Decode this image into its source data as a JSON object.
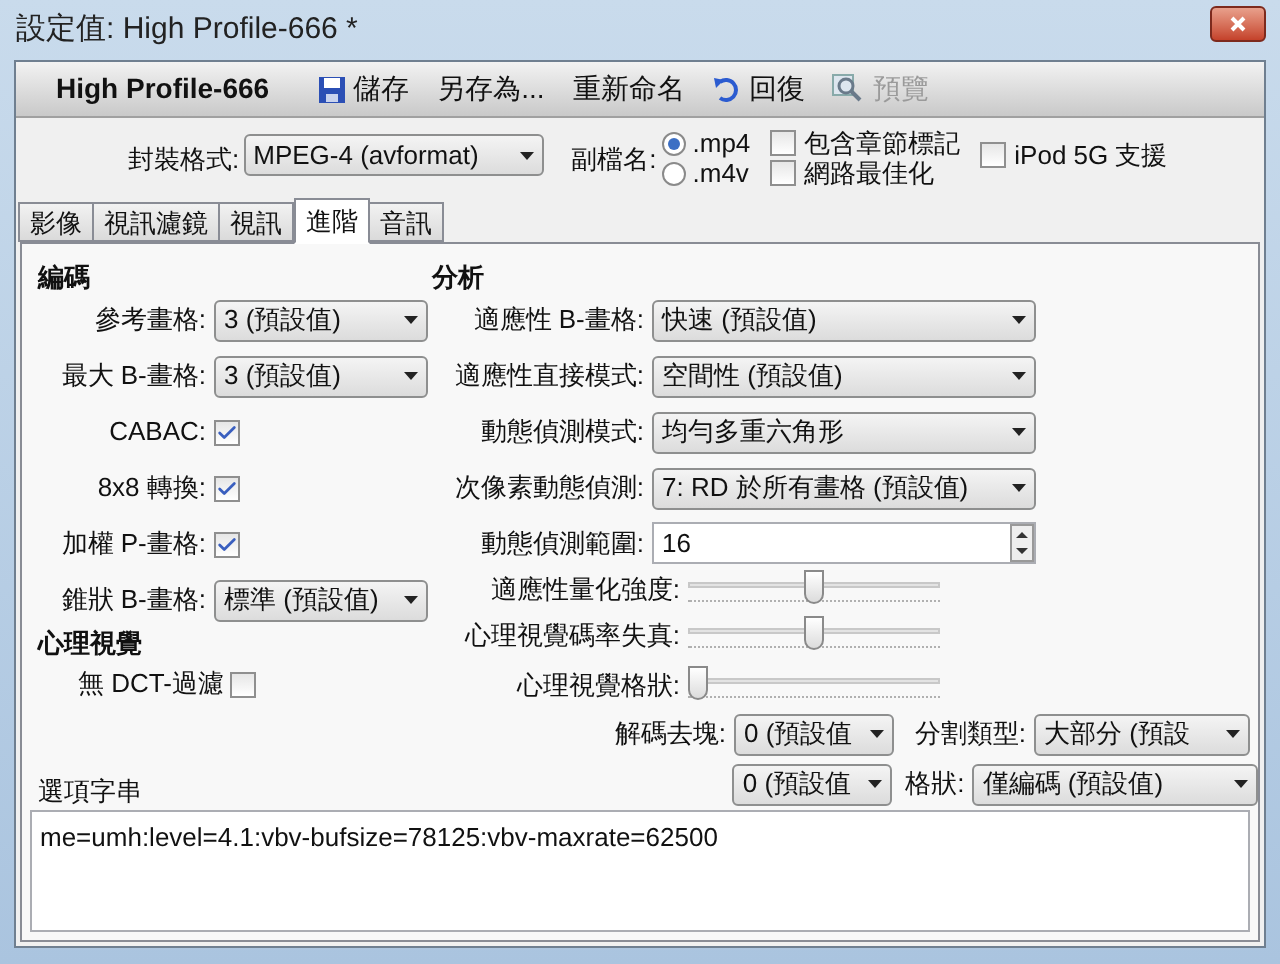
{
  "window": {
    "title": "設定值: High Profile-666 *"
  },
  "toolbar": {
    "preset_name": "High Profile-666",
    "buttons": [
      {
        "label": "儲存",
        "kind": "save",
        "disabled": false
      },
      {
        "label": "另存為...",
        "kind": "text",
        "disabled": false
      },
      {
        "label": "重新命名",
        "kind": "text",
        "disabled": false
      },
      {
        "label": "回復",
        "kind": "undo",
        "disabled": false
      },
      {
        "label": "預覽",
        "kind": "preview",
        "disabled": true
      }
    ]
  },
  "format": {
    "label": "封裝格式:",
    "value": "MPEG-4 (avformat)"
  },
  "extension": {
    "label": "副檔名:",
    "options": [
      {
        "label": ".mp4",
        "selected": true
      },
      {
        "label": ".m4v",
        "selected": false
      }
    ]
  },
  "checkboxes": [
    {
      "label": "包含章節標記",
      "checked": false
    },
    {
      "label": "網路最佳化",
      "checked": false
    },
    {
      "label": "iPod 5G 支援",
      "checked": false
    }
  ],
  "tabs": [
    {
      "label": "影像",
      "selected": false
    },
    {
      "label": "視訊濾鏡",
      "selected": false
    },
    {
      "label": "視訊",
      "selected": false
    },
    {
      "label": "進階",
      "selected": true
    },
    {
      "label": "音訊",
      "selected": false
    }
  ],
  "encoding": {
    "heading": "編碼",
    "fields": [
      {
        "kind": "select",
        "label": "參考畫格:",
        "value": "3 (預設值)"
      },
      {
        "kind": "select",
        "label": "最大 B-畫格:",
        "value": "3 (預設值)"
      },
      {
        "kind": "checkbox",
        "label": "CABAC:",
        "checked": true
      },
      {
        "kind": "checkbox",
        "label": "8x8 轉換:",
        "checked": true
      },
      {
        "kind": "checkbox",
        "label": "加權 P-畫格:",
        "checked": true
      },
      {
        "kind": "select",
        "label": "錐狀 B-畫格:",
        "value": "標準 (預設值)"
      }
    ]
  },
  "psychovisual": {
    "heading": "心理視覺",
    "fields": [
      {
        "kind": "checkbox",
        "label": "無 DCT-過濾",
        "checked": false
      }
    ]
  },
  "analysis": {
    "heading": "分析",
    "fields": [
      {
        "kind": "select",
        "label": "適應性 B-畫格:",
        "value": "快速 (預設值)"
      },
      {
        "kind": "select",
        "label": "適應性直接模式:",
        "value": "空間性 (預設值)"
      },
      {
        "kind": "select",
        "label": "動態偵測模式:",
        "value": "均勻多重六角形"
      },
      {
        "kind": "select",
        "label": "次像素動態偵測:",
        "value": "7: RD 於所有畫格 (預設值)"
      },
      {
        "kind": "spin",
        "label": "動態偵測範圍:",
        "value": "16"
      },
      {
        "kind": "slider",
        "label": "適應性量化強度:",
        "level": 0.5
      },
      {
        "kind": "slider",
        "label": "心理視覺碼率失真:",
        "level": 0.5
      },
      {
        "kind": "slider",
        "label": "心理視覺格狀:",
        "level": 0
      }
    ]
  },
  "deblock": {
    "label": "解碼去塊:",
    "values": [
      "0 (預設值",
      "0 (預設值"
    ]
  },
  "partition": {
    "label": "分割類型:",
    "value": "大部分 (預設"
  },
  "trellis": {
    "label": "格狀:",
    "value": "僅編碼 (預設值)"
  },
  "options": {
    "label": "選項字串",
    "value": "me=umh:level=4.1:vbv-bufsize=78125:vbv-maxrate=62500"
  }
}
